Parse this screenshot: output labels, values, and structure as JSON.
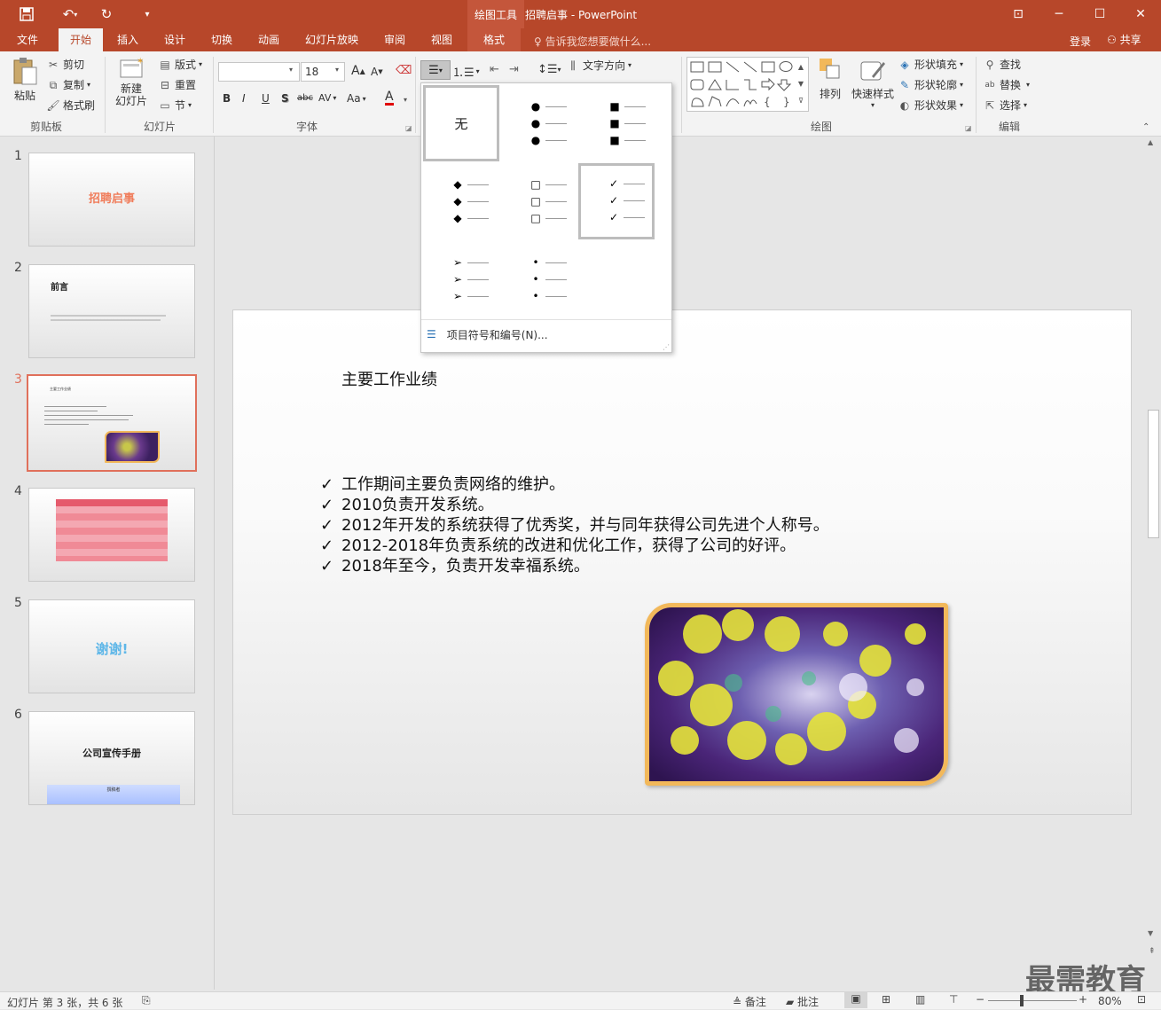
{
  "app": {
    "contextual_label": "绘图工具",
    "document_title": "招聘启事 - PowerPoint"
  },
  "tabs": [
    "文件",
    "开始",
    "插入",
    "设计",
    "切换",
    "动画",
    "幻灯片放映",
    "审阅",
    "视图",
    "格式"
  ],
  "tell_me": "告诉我您想要做什么...",
  "login": "登录",
  "share": "共享",
  "clipboard": {
    "paste": "粘贴",
    "cut": "剪切",
    "copy": "复制",
    "format_painter": "格式刷",
    "label": "剪贴板"
  },
  "slides_group": {
    "new_slide": "新建\n幻灯片",
    "layout": "版式",
    "reset": "重置",
    "section": "节",
    "label": "幻灯片"
  },
  "font_group": {
    "font_name": "",
    "font_size": "18",
    "label": "字体",
    "grow": "A",
    "shrink": "A",
    "bold": "B",
    "italic": "I",
    "underline": "U",
    "shadow": "S",
    "strike": "abc",
    "spacing": "AV",
    "case": "Aa",
    "color": "A"
  },
  "paragraph_group": {
    "text_direction": "文字方向"
  },
  "drawing_group": {
    "arrange": "排列",
    "quick_styles": "快速样式",
    "fill": "形状填充",
    "outline": "形状轮廓",
    "effects": "形状效果",
    "label": "绘图"
  },
  "editing_group": {
    "find": "查找",
    "replace": "替换",
    "select": "选择",
    "label": "编辑"
  },
  "bullet_menu": {
    "none": "无",
    "styles": [
      {
        "name": "filled-round",
        "symbol": "●"
      },
      {
        "name": "filled-square",
        "symbol": "■"
      },
      {
        "name": "diamond",
        "symbol": "◆"
      },
      {
        "name": "hollow-square",
        "symbol": "□"
      },
      {
        "name": "checkmark",
        "symbol": "✓"
      },
      {
        "name": "arrow",
        "symbol": "➢"
      },
      {
        "name": "small-dot",
        "symbol": "•"
      }
    ],
    "selected": "checkmark",
    "footer": "项目符号和编号(N)..."
  },
  "slides": [
    {
      "num": "1",
      "title": "招聘启事"
    },
    {
      "num": "2",
      "title": "前言"
    },
    {
      "num": "3",
      "title": "主要工作业绩",
      "selected": true
    },
    {
      "num": "4",
      "title": ""
    },
    {
      "num": "5",
      "title": "谢谢!"
    },
    {
      "num": "6",
      "title": "公司宣传手册",
      "subtitle": "撰稿者"
    }
  ],
  "current_slide": {
    "title": "主要工作业绩",
    "bullet_symbol": "✓",
    "bullets": [
      "工作期间主要负责网络的维护。",
      "2010负责开发系统。",
      "2012年开发的系统获得了优秀奖，并与同年获得公司先进个人称号。",
      "2012-2018年负责系统的改进和优化工作，获得了公司的好评。",
      "2018年至今，负责开发幸福系统。"
    ]
  },
  "status": {
    "slide_info": "幻灯片 第 3 张，共 6 张",
    "notes": "备注",
    "comments": "批注",
    "zoom": "80%"
  },
  "watermark": "最需教育",
  "colors": {
    "accent": "#b7472a",
    "selection": "#e0705b",
    "picture_border": "#f2b85a"
  }
}
